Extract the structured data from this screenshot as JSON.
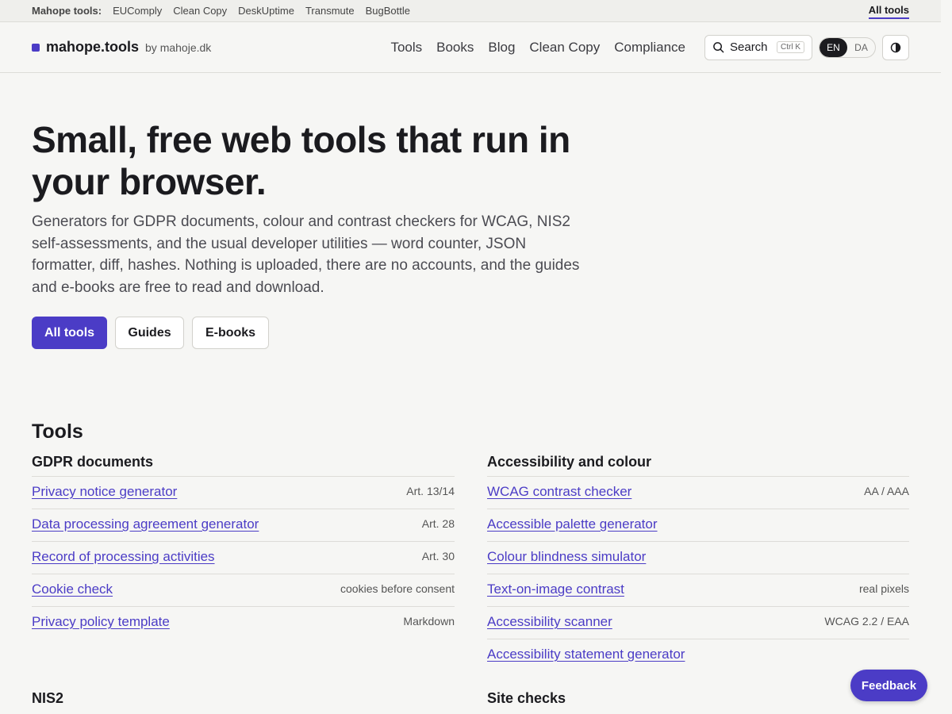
{
  "topstrip": {
    "lead": "Mahope tools:",
    "sites": [
      "EUComply",
      "Clean Copy",
      "DeskUptime",
      "Transmute",
      "BugBottle"
    ],
    "all_tools": "All tools"
  },
  "header": {
    "brand": "mahope.tools",
    "by": "by mahoje.dk",
    "nav": [
      "Tools",
      "Books",
      "Blog",
      "Clean Copy",
      "Compliance"
    ],
    "search_label": "Search",
    "search_shortcut": "Ctrl K",
    "lang_active": "EN",
    "lang_other": "DA"
  },
  "hero": {
    "title_line1": "Small, free web tools that run in",
    "title_line2": "your browser.",
    "description": "Generators for GDPR documents, colour and contrast checkers for WCAG, NIS2 self-assessments, and the usual developer utilities — word counter, JSON formatter, diff, hashes. Nothing is uploaded, there are no accounts, and the guides and e-books are free to read and download.",
    "cta_primary": "All tools",
    "cta_guides": "Guides",
    "cta_ebooks": "E-books"
  },
  "tools": {
    "heading": "Tools",
    "gdpr": {
      "heading": "GDPR documents",
      "items": [
        {
          "label": "Privacy notice generator",
          "tag": "Art. 13/14"
        },
        {
          "label": "Data processing agreement generator",
          "tag": "Art. 28"
        },
        {
          "label": "Record of processing activities",
          "tag": "Art. 30"
        },
        {
          "label": "Cookie check",
          "tag": "cookies before consent"
        },
        {
          "label": "Privacy policy template",
          "tag": "Markdown"
        }
      ]
    },
    "a11y": {
      "heading": "Accessibility and colour",
      "items": [
        {
          "label": "WCAG contrast checker",
          "tag": "AA / AAA"
        },
        {
          "label": "Accessible palette generator",
          "tag": ""
        },
        {
          "label": "Colour blindness simulator",
          "tag": ""
        },
        {
          "label": "Text-on-image contrast",
          "tag": "real pixels"
        },
        {
          "label": "Accessibility scanner",
          "tag": "WCAG 2.2 / EAA"
        },
        {
          "label": "Accessibility statement generator",
          "tag": ""
        }
      ]
    },
    "next_left": "NIS2",
    "next_right": "Site checks"
  },
  "feedback": "Feedback",
  "colors": {
    "accent": "#4b3cc6",
    "background": "#f6f6f4",
    "text": "#1b1b1f"
  }
}
